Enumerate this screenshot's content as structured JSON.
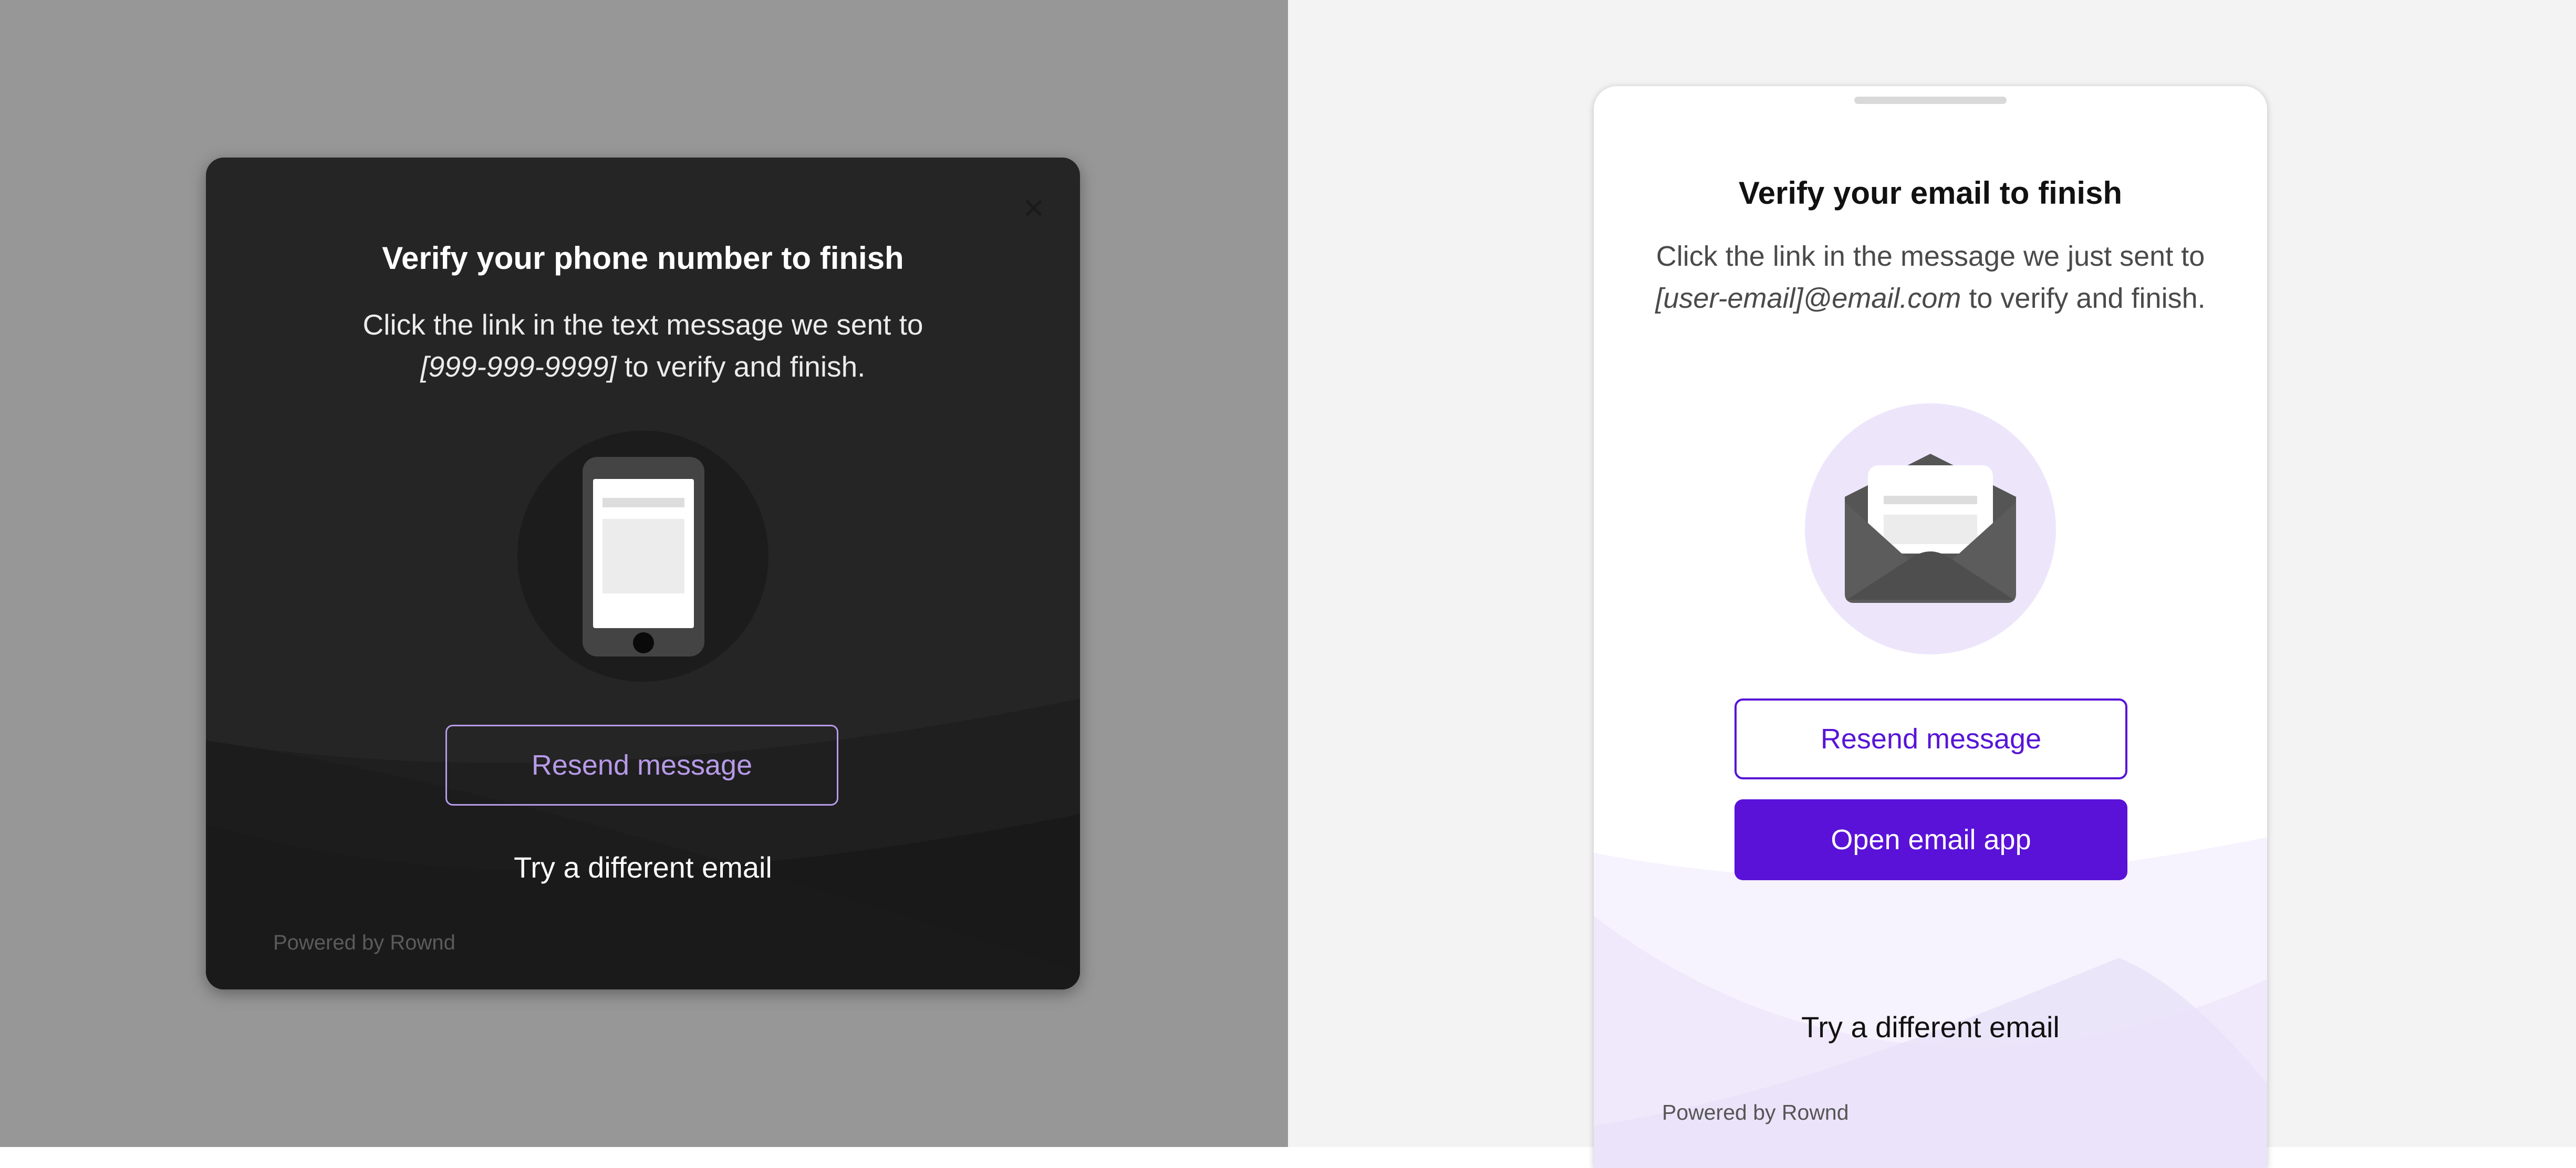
{
  "dark_modal": {
    "close_icon": "close-icon",
    "close_glyph": "✕",
    "title": "Verify your phone number to finish",
    "body_prefix": "Click the link in the text message we sent to",
    "phone_placeholder": "[999-999-9999]",
    "body_suffix": " to verify and finish.",
    "illustration_icon": "phone-illustration-icon",
    "resend_label": "Resend message",
    "try_label": "Try a different email",
    "powered_by": "Powered by Rownd",
    "colors": {
      "background": "#252525",
      "accent": "#b79ae8",
      "text": "#ffffff"
    }
  },
  "light_sheet": {
    "title": "Verify your email to finish",
    "body_prefix": "Click the link in the message we just sent to ",
    "email_placeholder": "[user-email]@email.com",
    "body_suffix": " to verify and finish.",
    "illustration_icon": "envelope-illustration-icon",
    "resend_label": "Resend message",
    "open_label": "Open email app",
    "try_label": "Try a different email",
    "powered_by": "Powered by Rownd",
    "colors": {
      "background": "#ffffff",
      "accent": "#5a12d8",
      "circle": "#ede6fb"
    }
  }
}
